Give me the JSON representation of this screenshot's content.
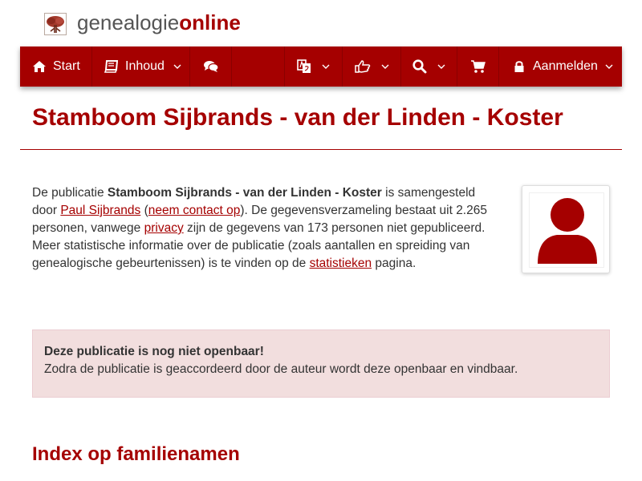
{
  "brand": {
    "name_part1": "genealogie",
    "name_part2": "online"
  },
  "nav": {
    "start": "Start",
    "inhoud": "Inhoud",
    "aanmelden": "Aanmelden"
  },
  "page": {
    "title": "Stamboom Sijbrands - van der Linden - Koster",
    "intro": {
      "t1": "De publicatie ",
      "pub_name": "Stamboom Sijbrands - van der Linden - Koster",
      "t2": " is samengesteld door ",
      "author_link": "Paul Sijbrands",
      "t3": " (",
      "contact_link": "neem contact op",
      "t4": "). De gegevensverzameling bestaat uit 2.265 personen, vanwege ",
      "privacy_link": "privacy",
      "t5": " zijn de gegevens van 173 personen niet gepubliceerd. Meer statistische informatie over de publicatie (zoals aantallen en spreiding van genealogische gebeurtenissen) is te vinden op de ",
      "stats_link": "statistieken",
      "t6": " pagina."
    },
    "alert": {
      "heading": "Deze publicatie is nog niet openbaar!",
      "body": "Zodra de publicatie is geaccordeerd door de auteur wordt deze openbaar en vindbaar."
    },
    "section_title": "Index op familienamen"
  },
  "icons": [
    "tree-logo-icon",
    "home-icon",
    "book-icon",
    "comments-icon",
    "language-icon",
    "thumbs-up-icon",
    "search-icon",
    "cart-icon",
    "lock-icon",
    "chevron-down-icon",
    "user-avatar-icon"
  ],
  "colors": {
    "accent": "#a50000",
    "alert_bg": "#f2dede",
    "text": "#333333"
  }
}
